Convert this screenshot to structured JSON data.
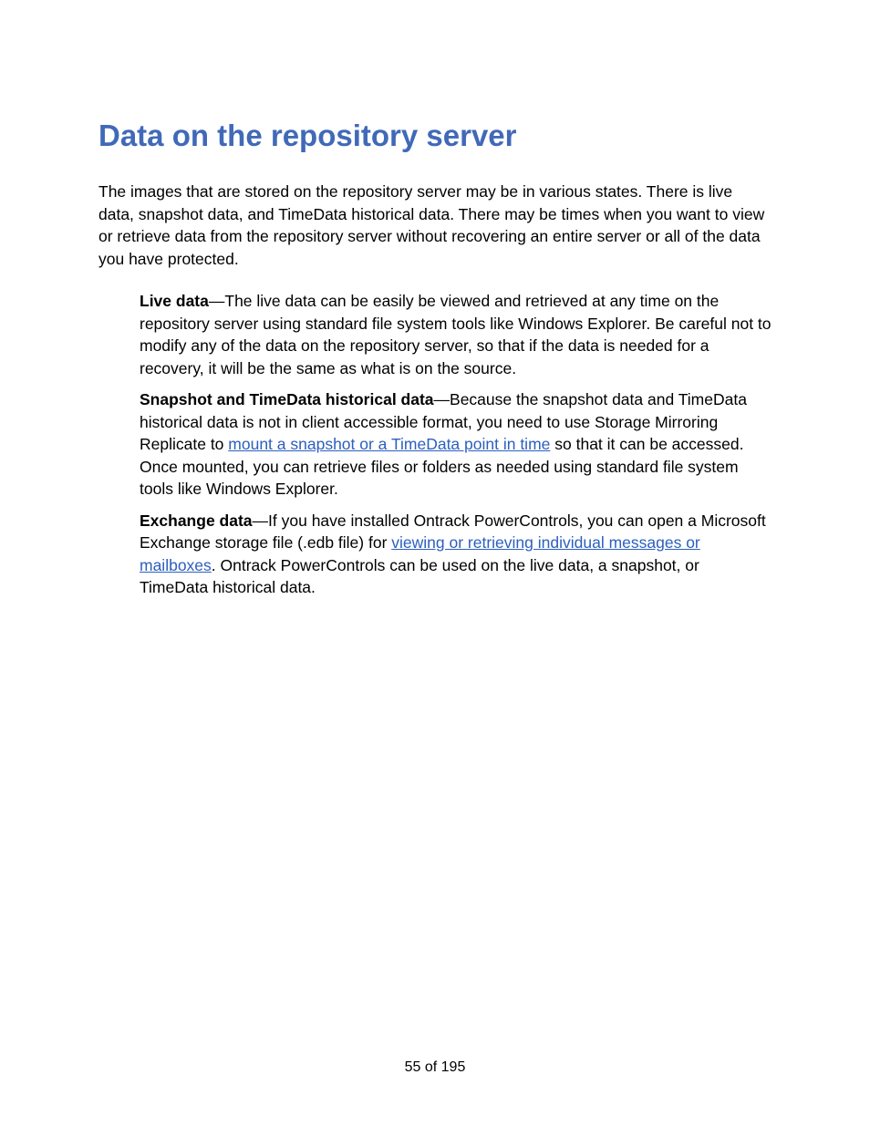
{
  "heading": "Data on the repository server",
  "intro": "The images that are stored on the repository server may be in various states. There is live data, snapshot data, and TimeData historical data. There may be times when you want to view or retrieve data from the repository server without recovering an entire server or all of the data you have protected.",
  "definitions": {
    "live_data": {
      "term": "Live data",
      "text": "—The live data can be easily be viewed and retrieved at any time on the repository server using standard file system tools like Windows Explorer. Be careful not to modify any of the data on the repository server, so that if the data is needed for a recovery, it will be the same as what is on the source."
    },
    "snapshot_data": {
      "term": "Snapshot and TimeData historical data",
      "text_before": "—Because the snapshot data and TimeData historical data is not in client accessible format, you need to use Storage Mirroring Replicate to ",
      "link": "mount a snapshot or a TimeData point in time",
      "text_after": " so that it can be accessed. Once mounted, you can retrieve files or folders as needed using standard file system tools like Windows Explorer."
    },
    "exchange_data": {
      "term": "Exchange data",
      "text_before": "—If you have installed Ontrack PowerControls, you can open a Microsoft Exchange storage file (.edb file) for ",
      "link": "viewing or retrieving individual messages or mailboxes",
      "text_after": ". Ontrack PowerControls can be used on the live data, a snapshot, or TimeData historical data."
    }
  },
  "footer": "55 of 195"
}
